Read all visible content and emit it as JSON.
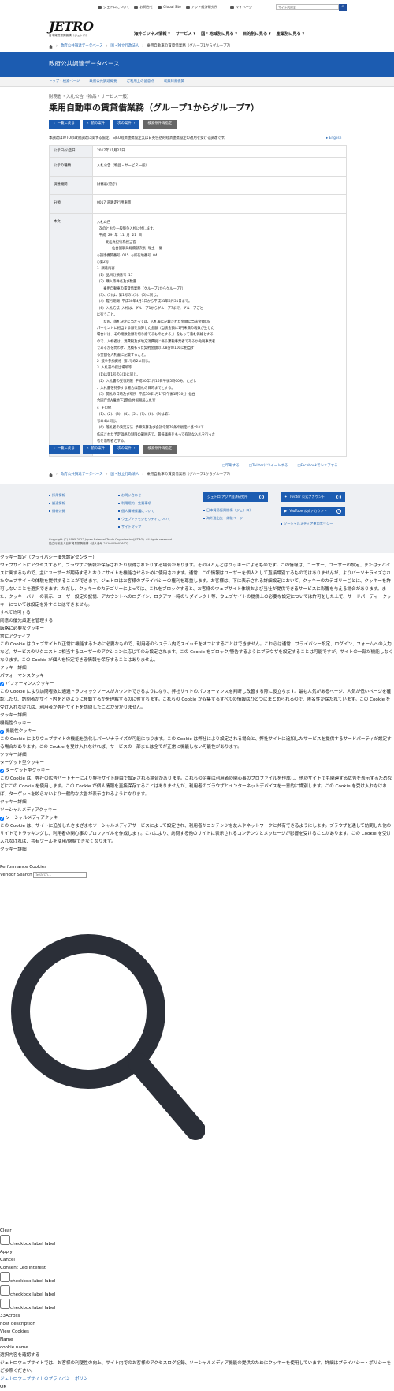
{
  "utility": {
    "links": [
      "ジェトロについて",
      "お問合せ",
      "Global Site",
      "アジア経済研究所",
      "マイページ"
    ],
    "search_placeholder": "サイト内検索"
  },
  "logo": {
    "name": "JETRO",
    "sub": "日本貿易振興機構（ジェトロ）"
  },
  "global_nav": [
    "海外ビジネス情報 ▾",
    "サービス ▾",
    "国・地域別に見る ▾",
    "目的別に見る ▾",
    "産業別に見る ▾"
  ],
  "breadcrumb": [
    "政府公共調達データベース",
    "国・独立行政法人",
    "乗用自動車の賃貸借業務（グループ1からグループ7）"
  ],
  "band_title": "政府公共調達データベース",
  "subnav": [
    "トップ・検索ページ",
    "政府公共調達概要",
    "ご利用上の留意点",
    "収録対象機関"
  ],
  "category": "財務省・入札公告（物品・サービス一般）",
  "page_title": "乗用自動車の賃貸借業務（グループ1からグループ7）",
  "buttons": {
    "back": "一覧に戻る",
    "prev": "前の案件",
    "next": "次の案件",
    "research": "検索条件再指定"
  },
  "notice": "本調達はWTOの政府調達に関する協定、日EU経済連携協定又は日英包括的経済連携協定の適用を受ける調達です。",
  "english": "English",
  "info": {
    "date_label": "公示日/公告日",
    "date": "2017年11月21日",
    "type_label": "公示の種類",
    "type": "入札公告（物品・サービス一般）",
    "org_label": "調達機関",
    "org": "財務省(官庁)",
    "class_label": "分類",
    "class": "0017 道路走行用車両",
    "body_label": "本文",
    "body": "入札公告\n  次のとおり一般競争入札に付します。\n  平成  29  年  11  月  21  日\n        支出負担行為担当官\n              仙台国税局総務部次長  堀土    勉\n◎調達機関番号  015  ◎所在地番号  04\n○第2号\n1  調達内容\n  (1)  品目分類番号  17\n  (2)  購入等件名及び数量\n      乗用自動車の賃貸借業務（グループ1からグループ7）\n  (3)、(5)は、第1号の1(3)、(5)に同じ。\n  (4)  履行期間  平成30年4月1日から平成31年3月31日まで。\n  (6)  入札方法  入札は、グループ1からグループ7まで、グループごと\nに行うこと。\n      なお、落札決定に当たっては、入札書に記載された金額に当該金額の8\nパーセントに相当する額を加算した金額（当該金額に1円未満の端数が生じた\n場合には、その端数金額を切り捨てるものとする。）をもって落札価格とする\nので、入札者は、消費税及び地方消費税に係る課税事業者であるか免税事業者\nであるかを問わず、見積もった契約金額の108分の100に相当す\nる金額を入札書に記載すること。\n2  競争参加資格  第1号の2に同じ。\n3  入札書の提出場所等\n  (1)は第1号の3(1)に同じ。\n  (2)  入札書の受領期限  平成30年1月16日午後5時00分。ただし\n、入札書を持参する場合は開札の日時までとする。\n  (3)  開札の日時及び場所  平成30年1月17日午後1時30分  仙台\n合同庁舎A棟地下1階仙台国税局入札室\n4  その他\n  (1)、(2)、(3)、(4)、(5)、(7)、(8)、(9)は第1\n号の4に同じ。\n  (6)  落札者の決定方法  予算決算及び会計令第79条の規定に基づいて\n作成された予定価格の制限の範囲内で、最低価格をもって有効な入札を行った\n者を落札者とする。"
  },
  "share": [
    "印刷する",
    "Twitterにツイートする",
    "Facebookでシェアする"
  ],
  "footer": {
    "col1": [
      "採用情報",
      "調達情報",
      "情報公開"
    ],
    "col2": [
      "お問い合わせ",
      "利用規約・免責事項",
      "個人情報保護について",
      "ウェブアクセシビリティについて",
      "サイトマップ"
    ],
    "col3_btn": "ジェトロ アジア経済研究所",
    "col3": [
      "日本貿易振興機構（ジェトロ）",
      "海外進出先・体験ページ"
    ],
    "col4_btns": [
      "Twitter 公式アカウント",
      "YouTube 公式アカウント"
    ],
    "col4": [
      "ソーシャルメディア運用ポリシー"
    ],
    "copyright": "Copyright (C) 1995-2022 Japan External Trade Organization(JETRO). All rights reserved.",
    "copyright2": "独立行政法人日本貿易振興機構（法人番号 2010405003602）"
  },
  "cookie": {
    "heading": "クッキー設定（プライバシー優先設定センター）",
    "intro": "ウェブサイトにアクセスすると、ブラウザに情報が保存されたり取得されたりする場合があります。そのほとんどはクッキーによるものです。この情報は、ユーザー、ユーザーの設定、またはデバイスに関するもので、主にユーザーが期待するとおりにサイトを機能させるために使用されます。通常、この情報はユーザーを個人として直接識別するものではありませんが、よりパーソナライズされたウェブサイトの体験を提供することができます。ジェトロはお客様のプライバシーの権利を尊重します。お客様は、下に表示される詳細設定において、クッキーのカテゴリーごとに、クッキーを許可しないことを選択できます。ただし、クッキーのカテゴリーによっては、これをブロックすると、お客様のウェブサイト体験および当社が提供できるサービスに影響を与える場合があります。また、クッキーバナーの表示、ユーザー設定の記憶、アカウントへのログイン、ログアウト時のリダイレクト等、ウェブサイトの提供上の必要な設定については許可をした上で、サードパーティークッキーについては設定を外すことはできません。",
    "allow_all": "すべて許可する",
    "manage": "同意の優先設定を管理する",
    "strict": "厳格に必要なクッキー",
    "always": "常にアクティブ",
    "strict_desc": "この Cookie はウェブサイトが正常に機能するために必要なもので、利用者のシステム内でスイッチをオフにすることはできません。これらは通常、プライバシー設定、ログイン、フォームへの入力など、サービスのリクエストに相当するユーザーのアクションに応じてのみ設定されます。この Cookie をブロック/警告するようにブラウザを設定することは可能ですが、サイトの一部が機能しなくなります。この Cookie が個人を特定できる情報を保存することはありません。",
    "detail": "クッキー詳細",
    "perf": "パフォーマンスクッキー",
    "perf_desc": "この Cookie により訪問者数と通過トラフィックソースがカウントできるようになり、弊社サイトのパフォーマンスを判断し改善する際に役立ちます。最も人気があるページ、人気が低いページを確認したり、訪問者がサイト内をどのように移動するかを理解するのに役立ちます。これらの Cookie が収集するすべての情報はひとつにまとめられるので、匿名性が保たれています。この Cookie を受け入れなければ、利用者が弊社サイトを訪問したことが分かりません。",
    "func": "機能性クッキー",
    "func_desc": "この Cookie によりウェブサイトの機能を強化しパーソナライズが可能になります。この Cookie は弊社により設定される場合と、弊社サイトに追加したサービスを提供するサードパーティが設定する場合があります。この Cookie を受け入れなければ、サービスの一部または全てが正常に機能しない可能性があります。",
    "target": "ターゲット型クッキー",
    "target_desc": "この Cookie は、弊社の広告パートナーにより弊社サイト経由で設定される場合があります。これらの企業は利用者の関心事のプロファイルを作成し、他のサイトでも関連する広告を表示するためなどにこの Cookie を使用します。この Cookie が個人情報を直接保存することはありませんが、利用者のブラウザとインターネットデバイスを一意的に識別します。この Cookie を受け入れなければ、ターゲットを絞らないより一般的な広告が表示されるようになります。",
    "social": "ソーシャルメディアクッキー",
    "social_desc": "この Cookie は、サイトに追加したさまざまなソーシャルメディアサービスによって設定され、利用者がコンテンツを友人やネットワークと共有できるようにします。ブラウザを通して訪問した他のサイトでトラッキングし、利用者の関心事のプロファイルを作成します。これにより、訪問する他のサイトに表示されるコンテンツとメッセージが影響を受けることがあります。この Cookie を受け入れなければ、共有ツールを使用/閲覧できなくなります。",
    "perf_cookies": "Performance Cookies",
    "vendor_search": "Vendor Search",
    "vendor_placeholder": "Search...",
    "clear": "Clear",
    "checkbox_label": "checkbox label label",
    "apply": "Apply",
    "cancel": "Cancel",
    "consent_leg": "Consent Leg.Interest",
    "across": "33Across",
    "host_desc": "host description",
    "view_cookies": "View Cookies",
    "name": "Name",
    "cookie_name": "cookie name",
    "confirm": "選択内容を確認する",
    "footer_text": "ジェトロウェブサイトでは、お客様の利便性の向上、サイト内でのお客様のアクセスログ記録、ソーシャルメディア機能の提供のためにクッキーを使用しています。詳細はプライバシー・ポリシーをご参照ください。",
    "policy_link": "ジェトロウェブサイトのプライバシーポリシー",
    "ok": "OK"
  }
}
